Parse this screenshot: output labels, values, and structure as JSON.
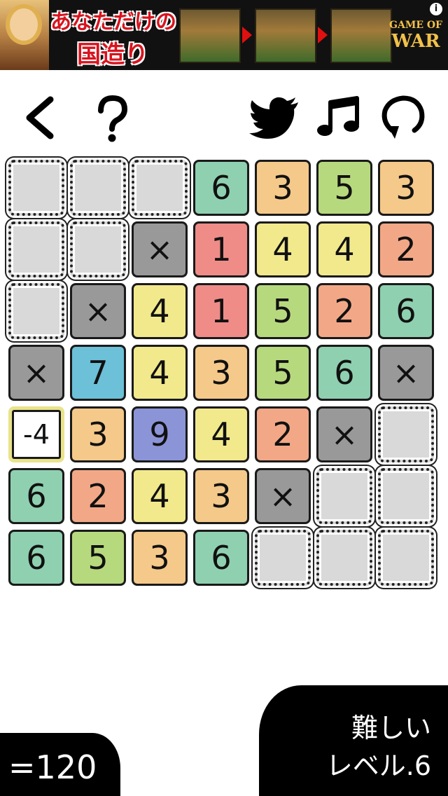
{
  "ad": {
    "line1": "あなただけの",
    "line2": "国造り",
    "logo_top": "GAME OF",
    "logo_bottom": "WAR",
    "info": "i"
  },
  "toolbar": {
    "back_icon": "chevron-left",
    "help_icon": "question-mark",
    "share_icon": "twitter-bird",
    "sound_icon": "music-note",
    "restart_icon": "refresh"
  },
  "colors": {
    "green": "#8fd0b0",
    "orange": "#f5c98a",
    "lime": "#b7d97e",
    "red": "#ef8c88",
    "yellow": "#f2e98c",
    "salmon": "#f2a887",
    "blue": "#6cc0d8",
    "purple": "#8c94d8",
    "gray": "#999999",
    "empty": "#d9d9d9"
  },
  "board": [
    [
      {
        "t": "empty"
      },
      {
        "t": "empty"
      },
      {
        "t": "empty"
      },
      {
        "t": "num",
        "v": "6",
        "c": "green"
      },
      {
        "t": "num",
        "v": "3",
        "c": "orange"
      },
      {
        "t": "num",
        "v": "5",
        "c": "lime"
      },
      {
        "t": "num",
        "v": "3",
        "c": "orange"
      }
    ],
    [
      {
        "t": "empty"
      },
      {
        "t": "empty"
      },
      {
        "t": "x",
        "v": "×"
      },
      {
        "t": "num",
        "v": "1",
        "c": "red"
      },
      {
        "t": "num",
        "v": "4",
        "c": "yellow"
      },
      {
        "t": "num",
        "v": "4",
        "c": "yellow"
      },
      {
        "t": "num",
        "v": "2",
        "c": "salmon"
      }
    ],
    [
      {
        "t": "empty"
      },
      {
        "t": "x",
        "v": "×"
      },
      {
        "t": "num",
        "v": "4",
        "c": "yellow"
      },
      {
        "t": "num",
        "v": "1",
        "c": "red"
      },
      {
        "t": "num",
        "v": "5",
        "c": "lime"
      },
      {
        "t": "num",
        "v": "2",
        "c": "salmon"
      },
      {
        "t": "num",
        "v": "6",
        "c": "green"
      }
    ],
    [
      {
        "t": "x",
        "v": "×"
      },
      {
        "t": "num",
        "v": "7",
        "c": "blue"
      },
      {
        "t": "num",
        "v": "4",
        "c": "yellow"
      },
      {
        "t": "num",
        "v": "3",
        "c": "orange"
      },
      {
        "t": "num",
        "v": "5",
        "c": "lime"
      },
      {
        "t": "num",
        "v": "6",
        "c": "green"
      },
      {
        "t": "x",
        "v": "×"
      }
    ],
    [
      {
        "t": "sel",
        "v": "-4"
      },
      {
        "t": "num",
        "v": "3",
        "c": "orange"
      },
      {
        "t": "num",
        "v": "9",
        "c": "purple"
      },
      {
        "t": "num",
        "v": "4",
        "c": "yellow"
      },
      {
        "t": "num",
        "v": "2",
        "c": "salmon"
      },
      {
        "t": "x",
        "v": "×"
      },
      {
        "t": "empty"
      }
    ],
    [
      {
        "t": "num",
        "v": "6",
        "c": "green"
      },
      {
        "t": "num",
        "v": "2",
        "c": "salmon"
      },
      {
        "t": "num",
        "v": "4",
        "c": "yellow"
      },
      {
        "t": "num",
        "v": "3",
        "c": "orange"
      },
      {
        "t": "x",
        "v": "×"
      },
      {
        "t": "empty"
      },
      {
        "t": "empty"
      }
    ],
    [
      {
        "t": "num",
        "v": "6",
        "c": "green"
      },
      {
        "t": "num",
        "v": "5",
        "c": "lime"
      },
      {
        "t": "num",
        "v": "3",
        "c": "orange"
      },
      {
        "t": "num",
        "v": "6",
        "c": "green"
      },
      {
        "t": "empty"
      },
      {
        "t": "empty"
      },
      {
        "t": "empty"
      }
    ]
  ],
  "score": "=120",
  "difficulty": "難しい",
  "level": "レベル.6"
}
